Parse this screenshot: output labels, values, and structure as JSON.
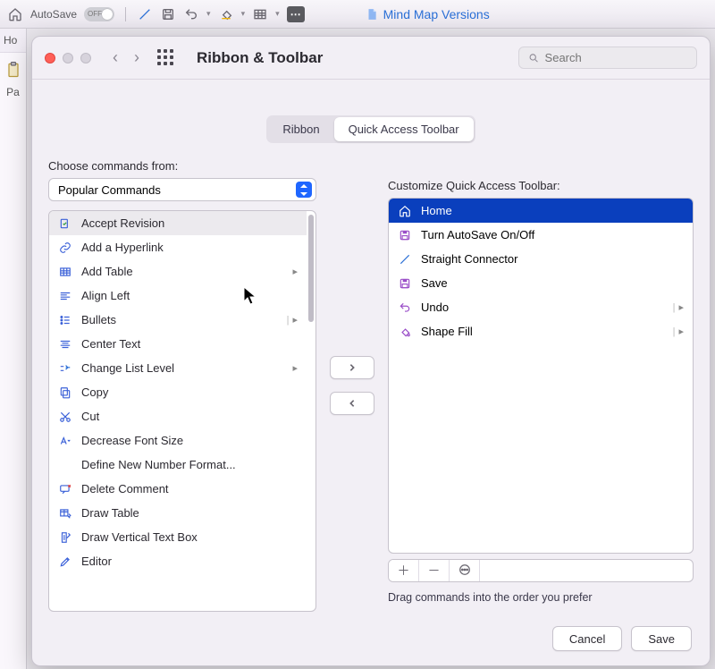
{
  "app_toolbar": {
    "autosave_label": "AutoSave",
    "autosave_state": "OFF",
    "doc_title": "Mind Map Versions"
  },
  "under": {
    "tab_home_abbrev": "Ho",
    "paste_abbrev": "Pa"
  },
  "dialog": {
    "title": "Ribbon & Toolbar",
    "search_placeholder": "Search",
    "tabs": {
      "ribbon": "Ribbon",
      "qat": "Quick Access Toolbar"
    },
    "active_tab": "qat",
    "choose_label": "Choose commands from:",
    "choose_value": "Popular Commands",
    "customize_label": "Customize Quick Access Toolbar:",
    "drag_hint": "Drag commands into the order you prefer",
    "cancel": "Cancel",
    "save": "Save"
  },
  "commands": [
    {
      "label": "Accept Revision",
      "selected": true
    },
    {
      "label": "Add a Hyperlink"
    },
    {
      "label": "Add Table",
      "submenu": true
    },
    {
      "label": "Align Left"
    },
    {
      "label": "Bullets",
      "submenu": true,
      "split": true
    },
    {
      "label": "Center Text"
    },
    {
      "label": "Change List Level",
      "submenu": true
    },
    {
      "label": "Copy"
    },
    {
      "label": "Cut"
    },
    {
      "label": "Decrease Font Size"
    },
    {
      "label": "Define New Number Format...",
      "noicon": true
    },
    {
      "label": "Delete Comment"
    },
    {
      "label": "Draw Table"
    },
    {
      "label": "Draw Vertical Text Box"
    },
    {
      "label": "Editor"
    }
  ],
  "qat_items": [
    {
      "label": "Home",
      "selected": true,
      "icon": "home"
    },
    {
      "label": "Turn AutoSave On/Off",
      "icon": "disk"
    },
    {
      "label": "Straight Connector",
      "icon": "line"
    },
    {
      "label": "Save",
      "icon": "disk"
    },
    {
      "label": "Undo",
      "icon": "undo",
      "submenu": true,
      "split": true
    },
    {
      "label": "Shape Fill",
      "icon": "bucket",
      "submenu": true,
      "split": true
    }
  ]
}
